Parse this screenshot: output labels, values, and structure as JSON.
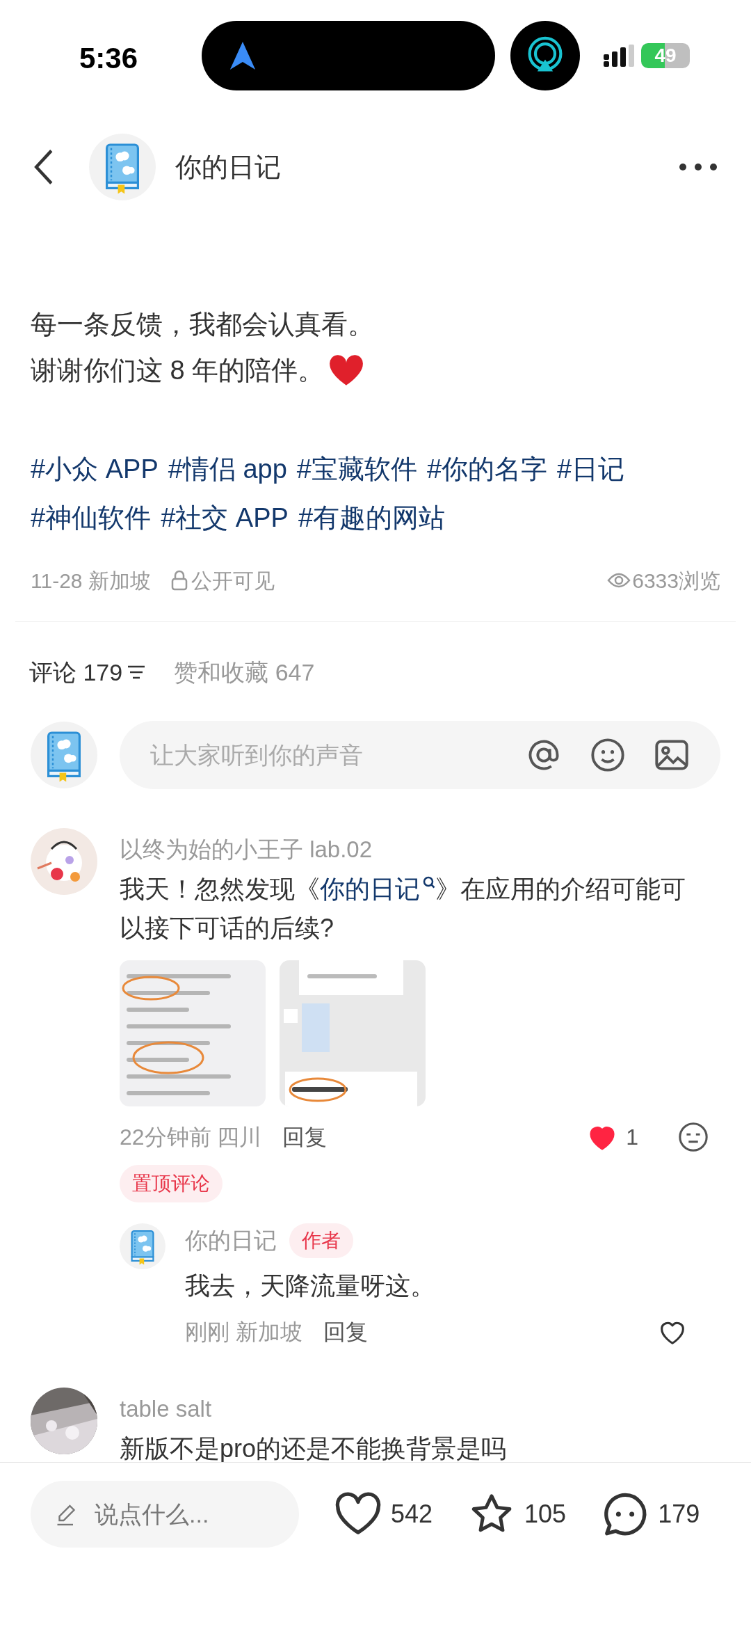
{
  "status_bar": {
    "time": "5:36",
    "battery": "49"
  },
  "header": {
    "title": "你的日记"
  },
  "post": {
    "paragraphs": [
      "每一条反馈，我都会认真看。",
      "谢谢你们这 8 年的陪伴。"
    ],
    "hashtags": [
      "#小众 APP",
      "#情侣 app",
      "#宝藏软件",
      "#你的名字",
      "#日记",
      "#神仙软件",
      "#社交 APP",
      "#有趣的网站"
    ],
    "date": "11-28 新加坡",
    "visibility": "公开可见",
    "views": "6333浏览"
  },
  "comment_tabs": [
    {
      "label": "评论 179",
      "selected": true
    },
    {
      "label": "赞和收藏 647",
      "selected": false
    }
  ],
  "comment_input": {
    "placeholder": "让大家听到你的声音"
  },
  "comments": [
    {
      "author": "以终为始的小王子 lab.02",
      "text_before": "我天！忽然发现《",
      "link": "你的日记",
      "text_after": "》在应用的介绍可能可以接下可话的后续?",
      "images": [
        {
          "kind": "picture"
        },
        {
          "kind": "picture"
        }
      ],
      "time": "22分钟前",
      "location": "四川",
      "reply_label": "回复",
      "liked": true,
      "likes": "1",
      "pinned_label": "置顶评论",
      "replies": [
        {
          "author": "你的日记",
          "badge": "作者",
          "text": "我去，天降流量呀这。",
          "time": "刚刚",
          "location": "新加坡",
          "reply_label": "回复",
          "liked": false
        }
      ]
    },
    {
      "author": "table salt",
      "text_before": "新版不是pro的还是不能换背景是吗"
    }
  ],
  "bottom_bar": {
    "placeholder": "说点什么...",
    "likes": "542",
    "favorites": "105",
    "comments": "179"
  }
}
